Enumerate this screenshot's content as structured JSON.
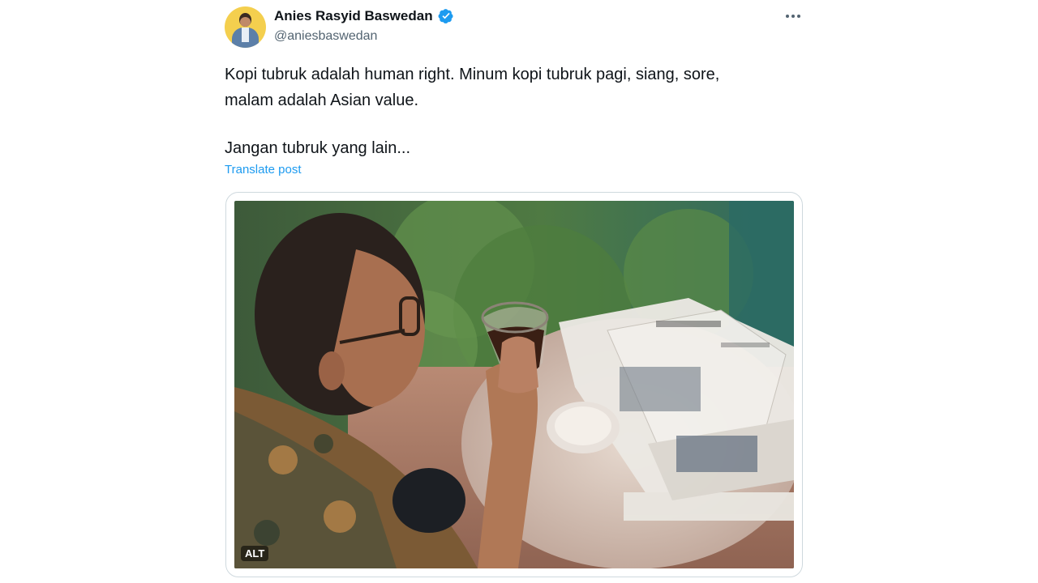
{
  "author": {
    "display_name": "Anies Rasyid Baswedan",
    "handle": "@aniesbaswedan",
    "verified": true,
    "avatar_icon": "profile-photo"
  },
  "post": {
    "lines": [
      "Kopi tubruk adalah human right. Minum kopi tubruk pagi, siang, sore,",
      "malam adalah Asian value."
    ],
    "line2": "Jangan tubruk yang lain...",
    "translate_label": "Translate post"
  },
  "media": {
    "alt_badge": "ALT",
    "description_icon": "photo-man-drinking-coffee-with-newspapers"
  },
  "colors": {
    "accent": "#1d9bf0",
    "text": "#0f1419",
    "secondary": "#536471",
    "border": "#cfd9de"
  }
}
